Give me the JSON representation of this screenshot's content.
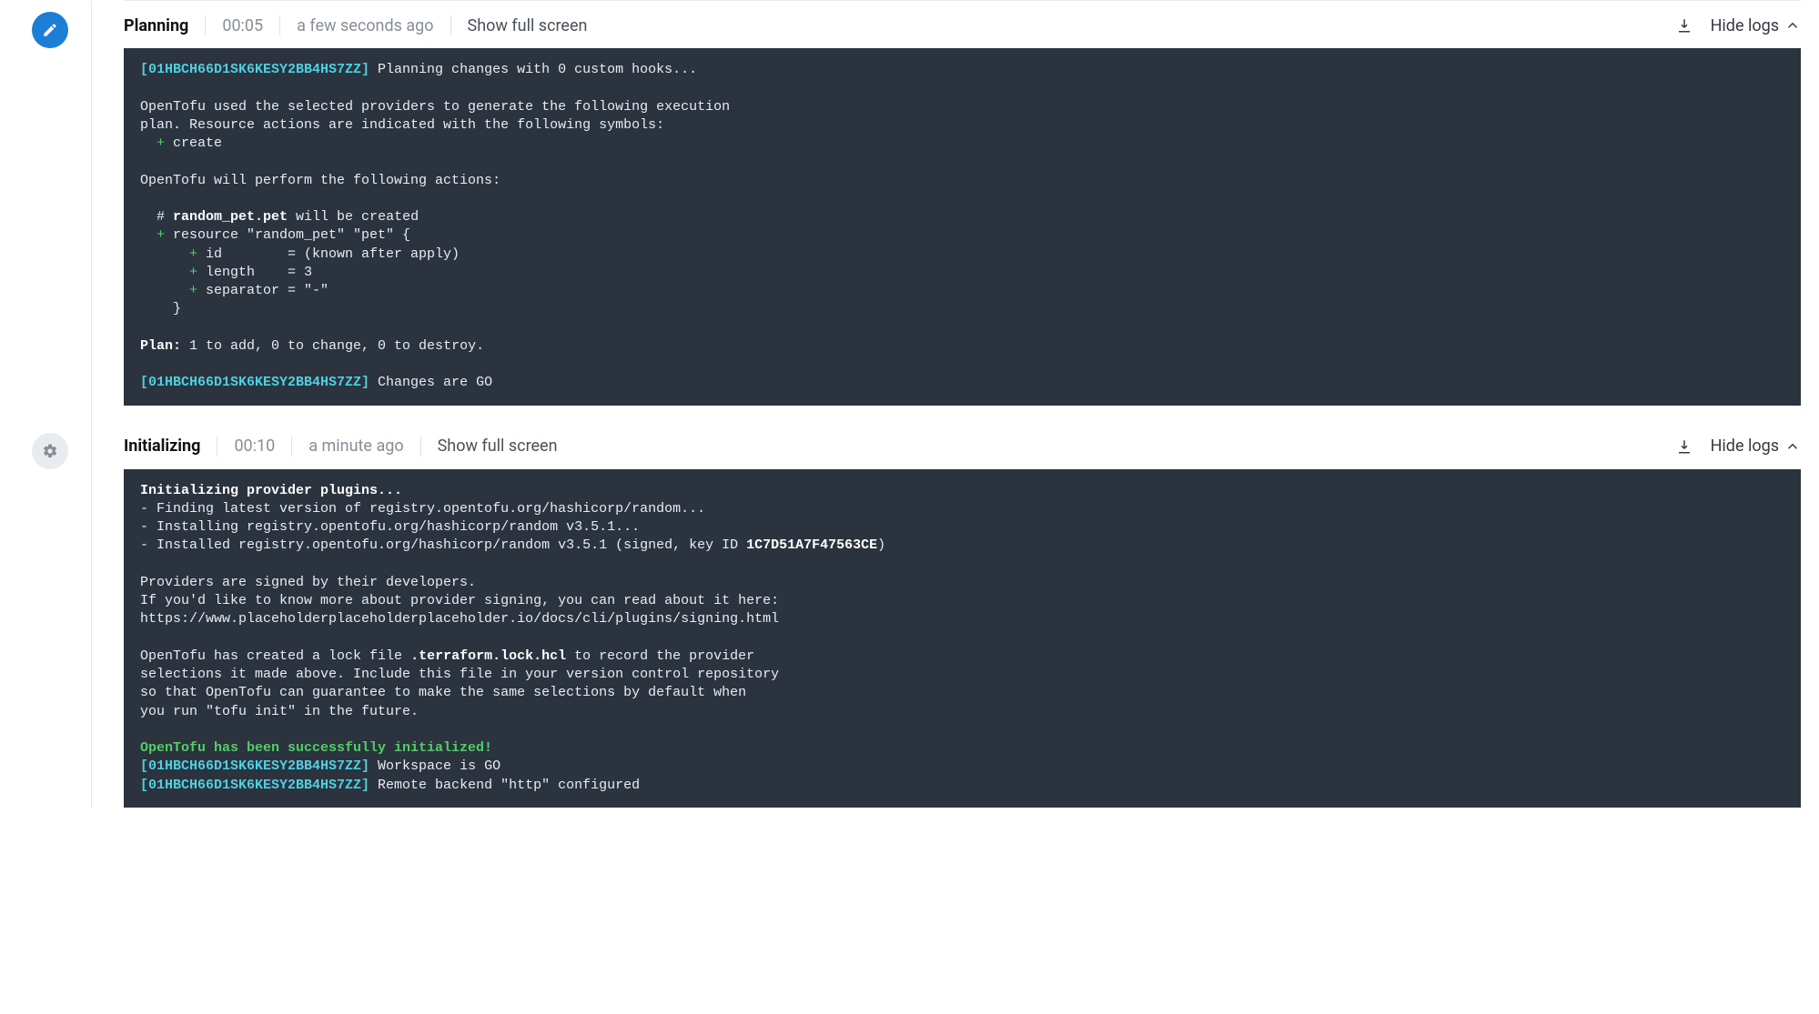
{
  "stages": [
    {
      "title": "Planning",
      "duration": "00:05",
      "relative_time": "a few seconds ago",
      "show_full_screen": "Show full screen",
      "hide_logs": "Hide logs",
      "icon": "pencil-icon",
      "log": {
        "trace_id": "[01HBCH66D1SK6KESY2BB4HS7ZZ]",
        "line1": " Planning changes with 0 custom hooks...",
        "intro1": "OpenTofu used the selected providers to generate the following execution",
        "intro2": "plan. Resource actions are indicated with the following symbols:",
        "sym_plus": "  +",
        "sym_create": " create",
        "actions_intro": "OpenTofu will perform the following actions:",
        "res_comment_pre": "  # ",
        "res_comment_bold": "random_pet.pet",
        "res_comment_post": " will be created",
        "res_plus": "  +",
        "res_open": " resource \"random_pet\" \"pet\" {",
        "attr1_plus": "      +",
        "attr1": " id        = (known after apply)",
        "attr2_plus": "      +",
        "attr2": " length    = 3",
        "attr3_plus": "      +",
        "attr3": " separator = \"-\"",
        "close": "    }",
        "plan_bold": "Plan:",
        "plan_rest": " 1 to add, 0 to change, 0 to destroy.",
        "trace_id2": "[01HBCH66D1SK6KESY2BB4HS7ZZ]",
        "changes_go": " Changes are GO"
      }
    },
    {
      "title": "Initializing",
      "duration": "00:10",
      "relative_time": "a minute ago",
      "show_full_screen": "Show full screen",
      "hide_logs": "Hide logs",
      "icon": "gear-icon",
      "log": {
        "init_bold": "Initializing provider plugins...",
        "line1": "- Finding latest version of registry.opentofu.org/hashicorp/random...",
        "line2": "- Installing registry.opentofu.org/hashicorp/random v3.5.1...",
        "line3_pre": "- Installed registry.opentofu.org/hashicorp/random v3.5.1 (signed, key ID ",
        "line3_bold": "1C7D51A7F47563CE",
        "line3_post": ")",
        "sign1": "Providers are signed by their developers.",
        "sign2": "If you'd like to know more about provider signing, you can read about it here:",
        "sign3": "https://www.placeholderplaceholderplaceholder.io/docs/cli/plugins/signing.html",
        "lock1_pre": "OpenTofu has created a lock file ",
        "lock1_bold": ".terraform.lock.hcl",
        "lock1_post": " to record the provider",
        "lock2": "selections it made above. Include this file in your version control repository",
        "lock3": "so that OpenTofu can guarantee to make the same selections by default when",
        "lock4": "you run \"tofu init\" in the future.",
        "success": "OpenTofu has been successfully initialized!",
        "trace1": "[01HBCH66D1SK6KESY2BB4HS7ZZ]",
        "ws_go": " Workspace is GO",
        "trace2": "[01HBCH66D1SK6KESY2BB4HS7ZZ]",
        "backend": " Remote backend \"http\" configured"
      }
    }
  ]
}
